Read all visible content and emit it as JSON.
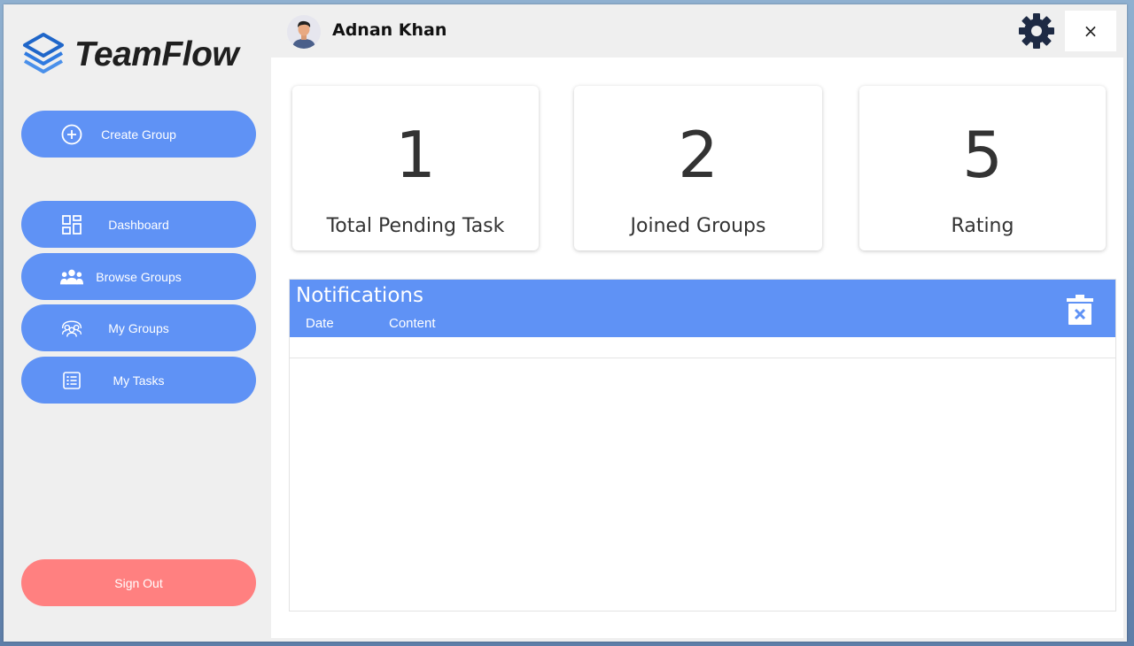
{
  "app": {
    "logo_text": "TeamFlow",
    "accent_color": "#5f92f5",
    "signout_color": "#ff8080"
  },
  "sidebar": {
    "create_group": {
      "label": "Create Group",
      "icon": "plus-circle-icon"
    },
    "items": [
      {
        "label": "Dashboard",
        "icon": "dashboard-grid-icon"
      },
      {
        "label": "Browse Groups",
        "icon": "people-group-icon"
      },
      {
        "label": "My Groups",
        "icon": "team-icon"
      },
      {
        "label": "My Tasks",
        "icon": "task-list-icon"
      }
    ],
    "sign_out": {
      "label": "Sign Out"
    }
  },
  "header": {
    "username": "Adnan Khan",
    "settings_icon": "gear-icon",
    "close_label": "×"
  },
  "stats": [
    {
      "value": "1",
      "caption": "Total Pending Task"
    },
    {
      "value": "2",
      "caption": "Joined Groups"
    },
    {
      "value": "5",
      "caption": "Rating"
    }
  ],
  "notifications": {
    "title": "Notifications",
    "columns": [
      "Date",
      "Content"
    ],
    "clear_icon": "clear-trash-icon",
    "rows": []
  }
}
